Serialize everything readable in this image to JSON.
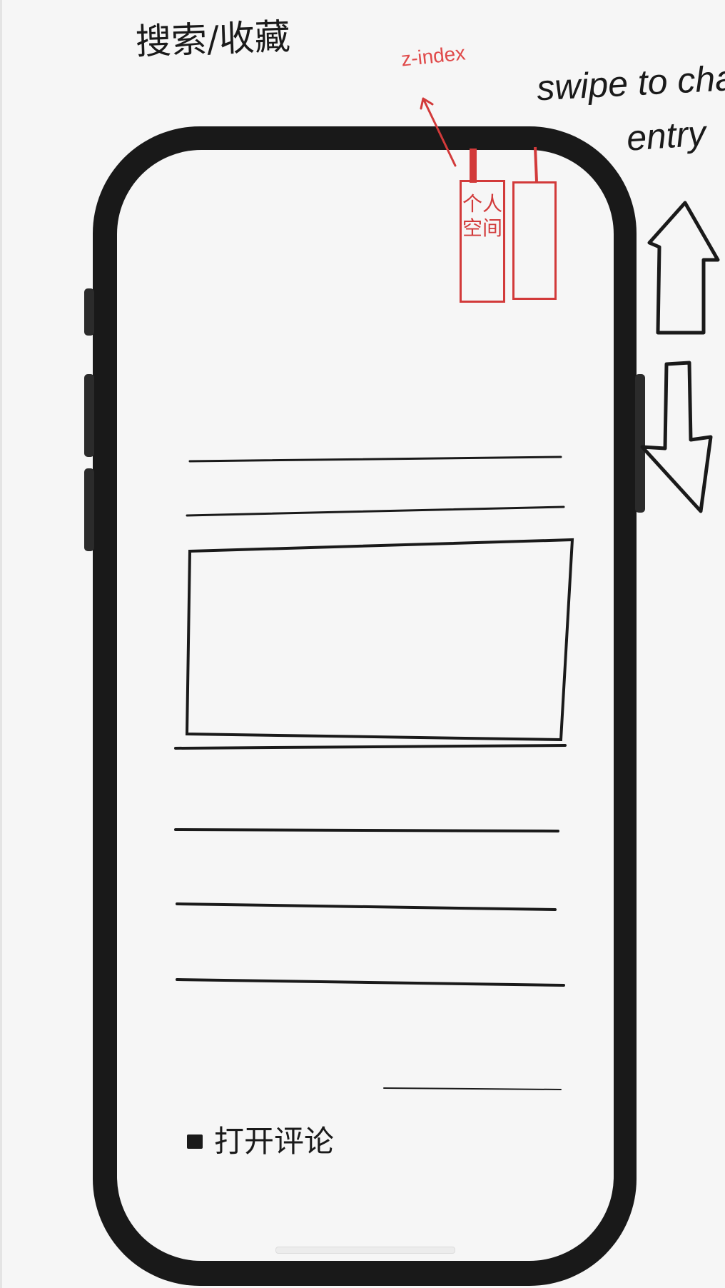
{
  "annotations": {
    "title": "搜索/收藏",
    "swipe_line_1": "swipe to change",
    "swipe_line_2": "entry",
    "zindex": "z-index"
  },
  "tabs": [
    {
      "label": "个人空间",
      "color": "#d23a3a"
    },
    {
      "label": "",
      "color": "#d23a3a"
    }
  ],
  "footer": {
    "checkbox_label": "打开评论",
    "checkbox_checked": true
  },
  "icons": {
    "up": "arrow-up-icon",
    "down": "arrow-down-icon",
    "pointer": "red-arrow-icon"
  }
}
